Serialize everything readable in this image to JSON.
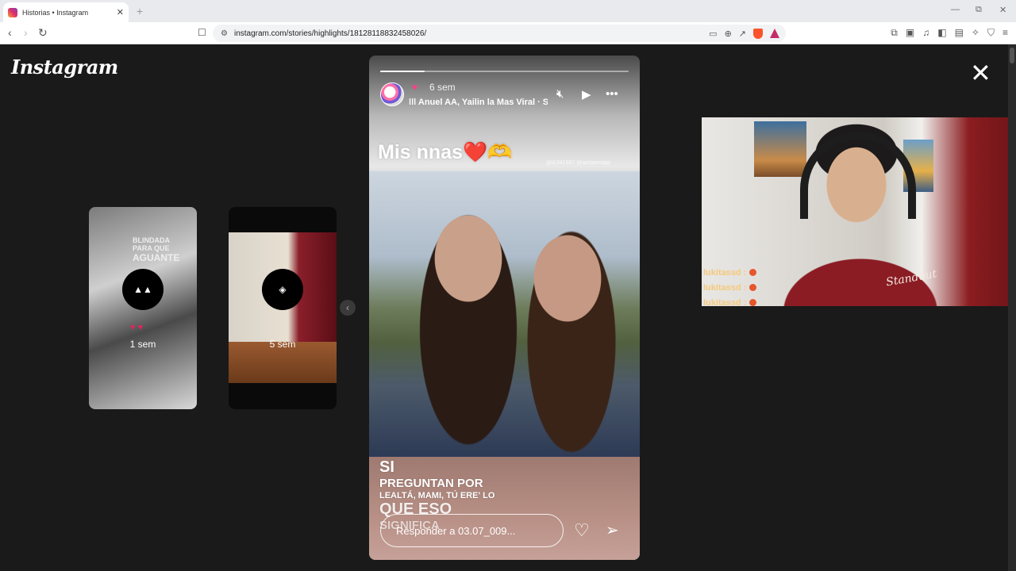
{
  "browser": {
    "tab_title": "Historias • Instagram",
    "tab_close": "✕",
    "new_tab": "+",
    "url": "instagram.com/stories/highlights/18128118832458026/",
    "win_minimize": "—",
    "win_restore": "⧉",
    "win_close": "✕"
  },
  "instagram": {
    "logo": "Instagram",
    "close": "✕",
    "previews": [
      {
        "time": "1 sem",
        "text_top": "BLINDADA",
        "text_mid": "PARA QUE",
        "text_big": "AGUANTE"
      },
      {
        "time": "5 sem"
      }
    ],
    "story": {
      "progress": 0.18,
      "time_ago": "6 sem",
      "music": "Anuel AA, Yailin la Mas Viral · S",
      "caption": "Mis nnas❤️🫶",
      "tags": "@d.041957 @aiztaaniapp",
      "bottom_lines": [
        "SI",
        "PREGUNTAN POR",
        "LEALTÁ, MAMI, TÚ ERE' LO",
        "QUE ESO",
        "SIGNIFICA"
      ],
      "reply_placeholder": "Responder a 03.07_009..."
    }
  },
  "chat": {
    "messages": [
      {
        "user": "lukitassd :"
      },
      {
        "user": "lukitassd :"
      },
      {
        "user": "lukitassd :"
      }
    ]
  },
  "webcam": {
    "shirt_logo": "Standout"
  }
}
